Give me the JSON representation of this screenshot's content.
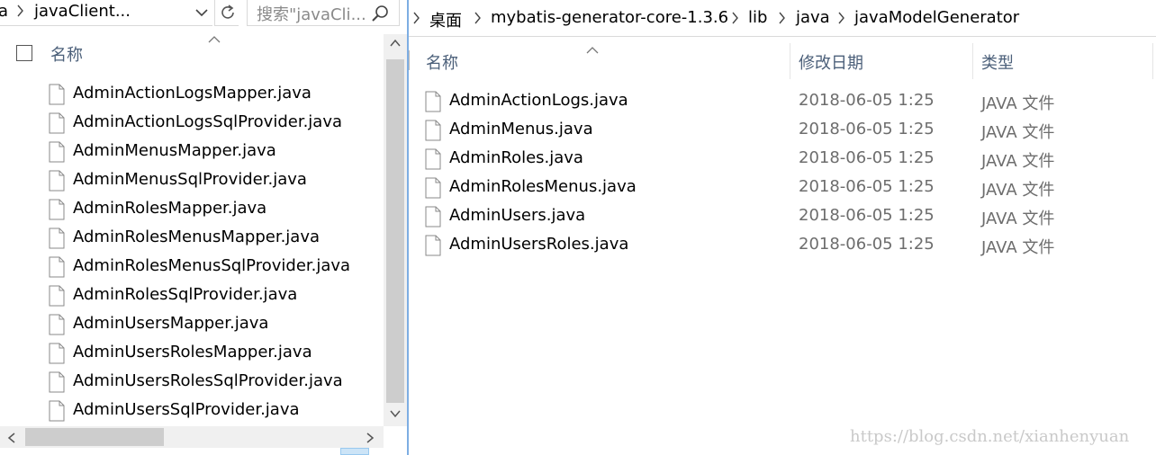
{
  "left": {
    "address": {
      "crumb_prefix": "a",
      "current_folder": "javaClient..."
    },
    "search": {
      "placeholder": "搜索\"javaCli..."
    },
    "header": {
      "name": "名称"
    },
    "files": [
      "AdminActionLogsMapper.java",
      "AdminActionLogsSqlProvider.java",
      "AdminMenusMapper.java",
      "AdminMenusSqlProvider.java",
      "AdminRolesMapper.java",
      "AdminRolesMenusMapper.java",
      "AdminRolesMenusSqlProvider.java",
      "AdminRolesSqlProvider.java",
      "AdminUsersMapper.java",
      "AdminUsersRolesMapper.java",
      "AdminUsersRolesSqlProvider.java",
      "AdminUsersSqlProvider.java"
    ]
  },
  "right": {
    "breadcrumb": [
      "桌面",
      "mybatis-generator-core-1.3.6",
      "lib",
      "java",
      "javaModelGenerator"
    ],
    "columns": {
      "name": "名称",
      "date": "修改日期",
      "type": "类型"
    },
    "files": [
      {
        "name": "AdminActionLogs.java",
        "date": "2018-06-05 1:25",
        "type": "JAVA 文件"
      },
      {
        "name": "AdminMenus.java",
        "date": "2018-06-05 1:25",
        "type": "JAVA 文件"
      },
      {
        "name": "AdminRoles.java",
        "date": "2018-06-05 1:25",
        "type": "JAVA 文件"
      },
      {
        "name": "AdminRolesMenus.java",
        "date": "2018-06-05 1:25",
        "type": "JAVA 文件"
      },
      {
        "name": "AdminUsers.java",
        "date": "2018-06-05 1:25",
        "type": "JAVA 文件"
      },
      {
        "name": "AdminUsersRoles.java",
        "date": "2018-06-05 1:25",
        "type": "JAVA 文件"
      }
    ]
  },
  "watermark": "https://blog.csdn.net/xianhenyuan",
  "colors": {
    "header_text": "#4c607a",
    "secondary_text": "#6d6d6d",
    "pane_divider": "#7eaee3"
  },
  "icons": [
    "chevron-down-icon",
    "refresh-icon",
    "search-icon",
    "chevron-right-icon",
    "file-icon"
  ]
}
